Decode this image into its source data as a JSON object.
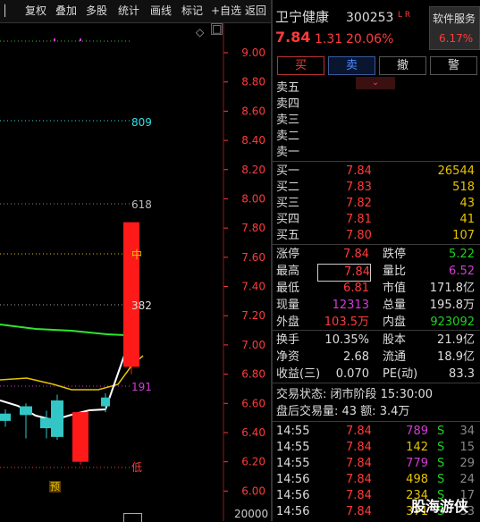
{
  "toolbar": {
    "items": [
      "复权",
      "叠加",
      "多股",
      "统计",
      "画线",
      "标记",
      "+自选",
      "返回"
    ]
  },
  "chart": {
    "price_ticks": [
      "9.00",
      "8.80",
      "8.60",
      "8.40",
      "8.20",
      "8.00",
      "7.80",
      "7.60",
      "7.40",
      "7.20",
      "7.00",
      "6.80",
      "6.60",
      "6.40",
      "6.20",
      "6.00"
    ],
    "volume_tick": "20000",
    "labels": {
      "l809": "809",
      "l618": "618",
      "l382": "382",
      "l191": "191",
      "mid": "中",
      "low": "低",
      "pre": "预",
      "top": "高"
    },
    "diamond": "◇",
    "candles": [
      {
        "o": 6.53,
        "c": 6.48,
        "h": 6.56,
        "l": 6.44,
        "color": "cyan"
      },
      {
        "o": 6.58,
        "c": 6.52,
        "h": 6.6,
        "l": 6.36,
        "color": "cyan"
      },
      {
        "o": 6.5,
        "c": 6.43,
        "h": 6.55,
        "l": 6.36,
        "color": "cyan"
      },
      {
        "o": 6.62,
        "c": 6.37,
        "h": 6.66,
        "l": 6.35,
        "color": "cyan"
      },
      {
        "o": 6.54,
        "c": 6.2,
        "h": 6.54,
        "l": 6.18,
        "color": "red"
      },
      {
        "o": 6.58,
        "c": 6.64,
        "h": 6.67,
        "l": 6.54,
        "color": "cyan"
      },
      {
        "o": 6.85,
        "c": 7.84,
        "h": 7.84,
        "l": 6.8,
        "color": "red"
      }
    ]
  },
  "stock": {
    "name": "卫宁健康",
    "code": "300253",
    "tags": "L R",
    "price": "7.84",
    "change": "1.31",
    "pct": "20.06%"
  },
  "sector": {
    "name": "软件服务",
    "pct": "6.17%"
  },
  "actions": [
    "买",
    "卖",
    "撤",
    "警"
  ],
  "sell": [
    "卖五",
    "卖四",
    "卖三",
    "卖二",
    "卖一"
  ],
  "buy": [
    {
      "label": "买一",
      "price": "7.84",
      "vol": "26544"
    },
    {
      "label": "买二",
      "price": "7.83",
      "vol": "518"
    },
    {
      "label": "买三",
      "price": "7.82",
      "vol": "43"
    },
    {
      "label": "买四",
      "price": "7.81",
      "vol": "41"
    },
    {
      "label": "买五",
      "price": "7.80",
      "vol": "107"
    }
  ],
  "stats": [
    {
      "l1": "涨停",
      "v1": "7.84",
      "c1": "red",
      "l2": "跌停",
      "v2": "5.22",
      "c2": "green"
    },
    {
      "l1": "最高",
      "v1": "7.84",
      "c1": "red",
      "l2": "量比",
      "v2": "6.52",
      "c2": "mag"
    },
    {
      "l1": "最低",
      "v1": "6.81",
      "c1": "red",
      "l2": "市值",
      "v2": "171.8亿",
      "c2": "w"
    },
    {
      "l1": "现量",
      "v1": "12313",
      "c1": "mag",
      "l2": "总量",
      "v2": "195.8万",
      "c2": "w"
    },
    {
      "l1": "外盘",
      "v1": "103.5万",
      "c1": "red",
      "l2": "内盘",
      "v2": "923092",
      "c2": "green"
    }
  ],
  "stats2": [
    {
      "l1": "换手",
      "v1": "10.35%",
      "l2": "股本",
      "v2": "21.9亿"
    },
    {
      "l1": "净资",
      "v1": "2.68",
      "l2": "流通",
      "v2": "18.9亿"
    },
    {
      "l1": "收益(三)",
      "v1": "0.070",
      "l2": "PE(动)",
      "v2": "83.3"
    }
  ],
  "status": {
    "line1": "交易状态: 闭市阶段 15:30:00",
    "line2": "盘后交易量: 43  额: 3.4万"
  },
  "ticks": [
    {
      "t": "14:55",
      "p": "7.84",
      "v": "789",
      "vc": "mag",
      "d": "S",
      "n": "34"
    },
    {
      "t": "14:55",
      "p": "7.84",
      "v": "142",
      "vc": "yellow",
      "d": "S",
      "n": "15"
    },
    {
      "t": "14:55",
      "p": "7.84",
      "v": "779",
      "vc": "mag",
      "d": "S",
      "n": "29"
    },
    {
      "t": "14:56",
      "p": "7.84",
      "v": "498",
      "vc": "yellow",
      "d": "S",
      "n": "24"
    },
    {
      "t": "14:56",
      "p": "7.84",
      "v": "234",
      "vc": "yellow",
      "d": "S",
      "n": "17"
    },
    {
      "t": "14:56",
      "p": "7.84",
      "v": "371",
      "vc": "yellow",
      "d": "S",
      "n": "33"
    }
  ],
  "watermark": "股海游侠"
}
